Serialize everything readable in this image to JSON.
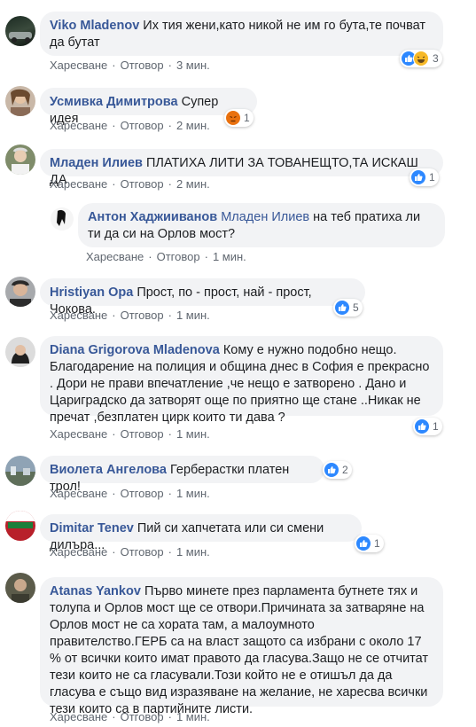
{
  "labels": {
    "like": "Харесване",
    "reply": "Отговор",
    "sep": "·"
  },
  "colors": {
    "author": "#385898",
    "bubble": "#f2f3f5",
    "like": "#2d88ff",
    "angry": "#e9710f",
    "haha": "#f7b928"
  },
  "comments": [
    {
      "author": "Viko Mladenov",
      "text": "Их тия жени,като никой не им го бута,те почват да бутат",
      "time": "3 мин.",
      "reactions": [
        "like-icon",
        "haha-icon"
      ],
      "count": "3"
    },
    {
      "author": "Усмивка Димитрова",
      "text": "Супер идея",
      "time": "2 мин.",
      "reactions": [
        "angry-icon"
      ],
      "count": "1"
    },
    {
      "author": "Младен Илиев",
      "text": "ПЛАТИХА ЛИТИ ЗА ТОВАНЕЩТО,ТА ИСКАШ ДА",
      "time": "2 мин.",
      "reactions": [
        "like-icon"
      ],
      "count": "1"
    },
    {
      "author": "Антон Хаджииванов",
      "mention": "Младен Илиев",
      "text": "на теб пратиха ли ти да си на Орлов мост?",
      "time": "1 мин."
    },
    {
      "author": "Hristiyan Opa",
      "text": "Прост, по - прост, най - прост, Чокова.",
      "time": "1 мин.",
      "reactions": [
        "like-icon"
      ],
      "count": "5"
    },
    {
      "author": "Diana Grigorova Mladenova",
      "text": "Кому е нужно подобно нещо. Благодарение на полиция и община днес в София е прекрасно . Дори не прави впечатление ,че нещо е затворено . Дано и Цариградско да затворят още по приятно ще стане ..Никак не пречат ,безплатен цирк които ти дава ?",
      "time": "1 мин.",
      "reactions": [
        "like-icon"
      ],
      "count": "1"
    },
    {
      "author": "Виолета Ангелова",
      "text": "Герберастки платен трол!",
      "time": "1 мин.",
      "reactions": [
        "like-icon"
      ],
      "count": "2"
    },
    {
      "author": "Dimitar Tenev",
      "text": "Пий си хапчетата или си смени дилъра...",
      "time": "1 мин.",
      "reactions": [
        "like-icon"
      ],
      "count": "1"
    },
    {
      "author": "Atanas Yankov",
      "text": "Първо минете през парламента бутнете тях и толупа и Орлов мост ще се отвори.Причината за затваряне на Орлов мост не са хората там, а малоумното правителство.ГЕРБ са на власт защото са избрани с около 17 % от всички които имат правото да гласува.Защо не се отчитат тези които не са гласували.Този който не е отишъл да да гласува е също вид изразяване на желание, не харесва всички тези които са в партийните листи.",
      "time": "1 мин."
    }
  ]
}
